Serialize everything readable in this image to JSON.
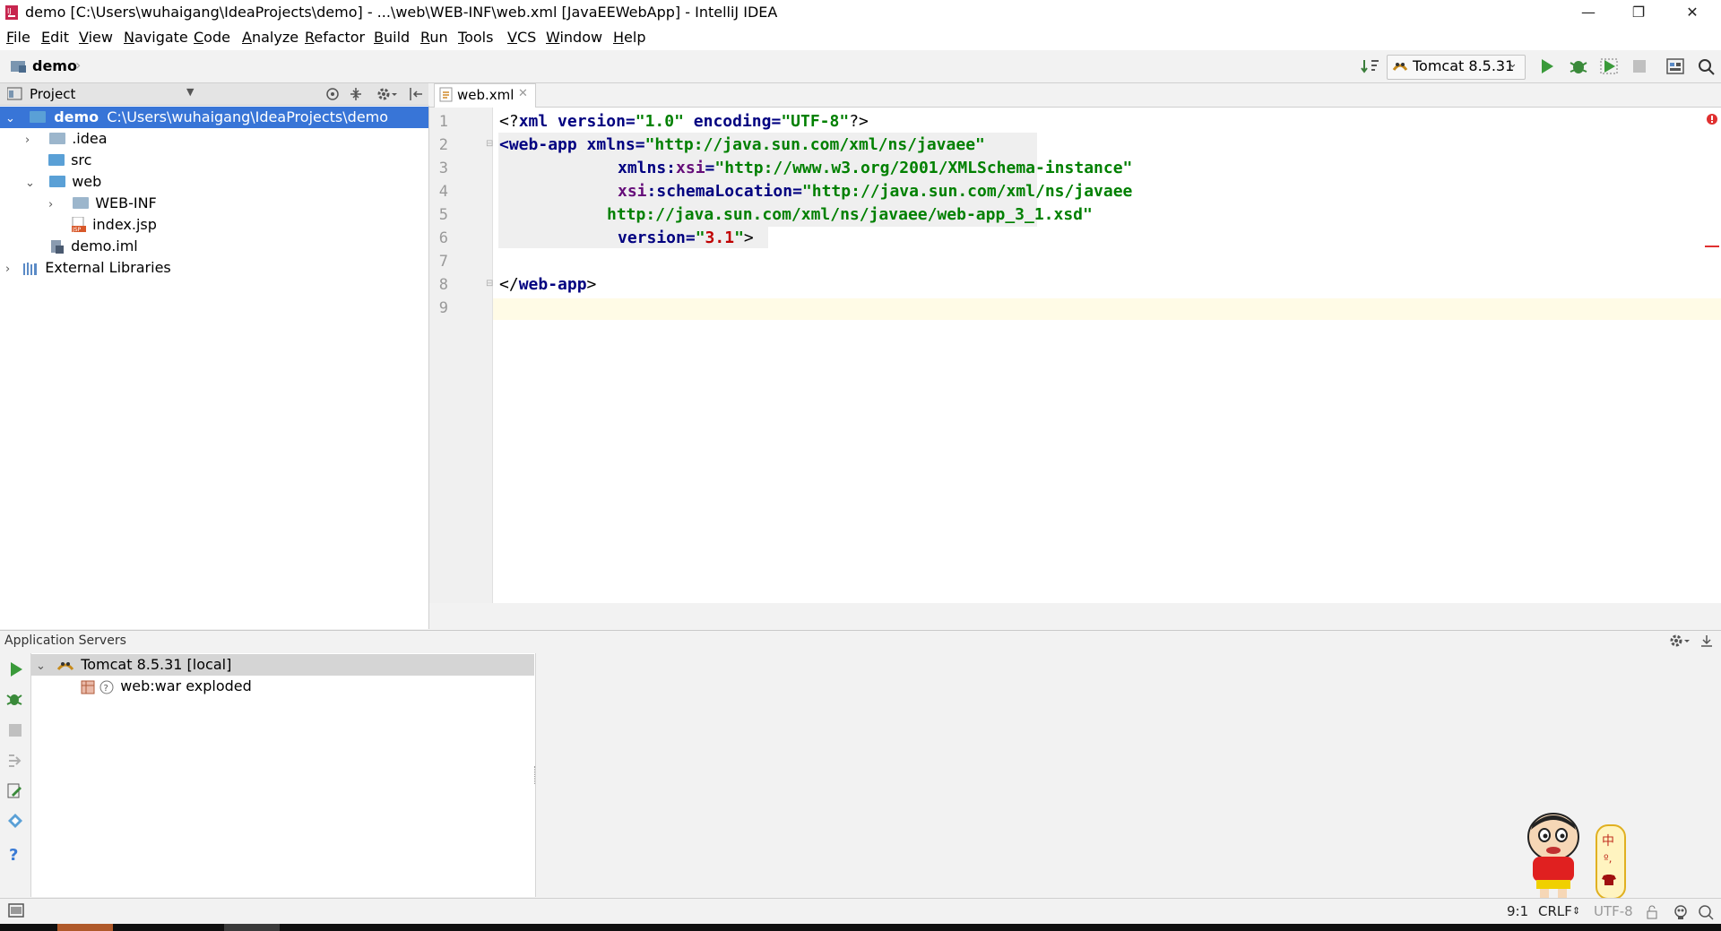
{
  "window": {
    "title": "demo [C:\\Users\\wuhaigang\\IdeaProjects\\demo] - ...\\web\\WEB-INF\\web.xml [JavaEEWebApp] - IntelliJ IDEA",
    "minimize": "—",
    "restore": "❐",
    "close": "✕"
  },
  "menu": [
    "File",
    "Edit",
    "View",
    "Navigate",
    "Code",
    "Analyze",
    "Refactor",
    "Build",
    "Run",
    "Tools",
    "VCS",
    "Window",
    "Help"
  ],
  "nav": {
    "breadcrumb": "demo"
  },
  "run_config": {
    "label": "Tomcat 8.5.31"
  },
  "project": {
    "header": "Project",
    "tree": [
      {
        "label": "demo",
        "path": "C:\\Users\\wuhaigang\\IdeaProjects\\demo"
      },
      {
        "label": ".idea"
      },
      {
        "label": "src"
      },
      {
        "label": "web"
      },
      {
        "label": "WEB-INF"
      },
      {
        "label": "index.jsp"
      },
      {
        "label": "demo.iml"
      },
      {
        "label": "External Libraries"
      }
    ]
  },
  "editor": {
    "tab": "web.xml",
    "line_numbers": [
      "1",
      "2",
      "3",
      "4",
      "5",
      "6",
      "7",
      "8",
      "9"
    ],
    "code": {
      "l1a": "<?",
      "l1b": "xml ",
      "l1c": "version",
      "l1d": "=",
      "l1e": "\"1.0\"",
      "l1f": " encoding",
      "l1g": "=",
      "l1h": "\"UTF-8\"",
      "l1i": "?>",
      "l2a": "<",
      "l2b": "web-app ",
      "l2c": "xmlns",
      "l2d": "=",
      "l2e": "\"http://java.sun.com/xml/ns/javaee\"",
      "l3a": "xmlns:",
      "l3b": "xsi",
      "l3c": "=",
      "l3d": "\"http://www.w3.org/2001/XMLSchema-instance\"",
      "l4a": "xsi",
      "l4b": ":schemaLocation",
      "l4c": "=",
      "l4d": "\"http://java.sun.com/xml/ns/javaee",
      "l5a": "http://java.sun.com/xml/ns/javaee/web-app_3_1.xsd\"",
      "l6a": "version",
      "l6b": "=",
      "l6c": "\"",
      "l6d": "3.1",
      "l6e": "\"",
      "l6f": ">",
      "l8a": "</",
      "l8b": "web-app",
      "l8c": ">"
    }
  },
  "servers": {
    "header": "Application Servers",
    "items": [
      {
        "label": "Tomcat 8.5.31 [local]"
      },
      {
        "label": "web:war exploded"
      }
    ]
  },
  "status": {
    "position": "9:1",
    "line_separator": "CRLF",
    "encoding": "UTF-8"
  },
  "ime": {
    "char1": "中",
    "char2": "º,"
  }
}
